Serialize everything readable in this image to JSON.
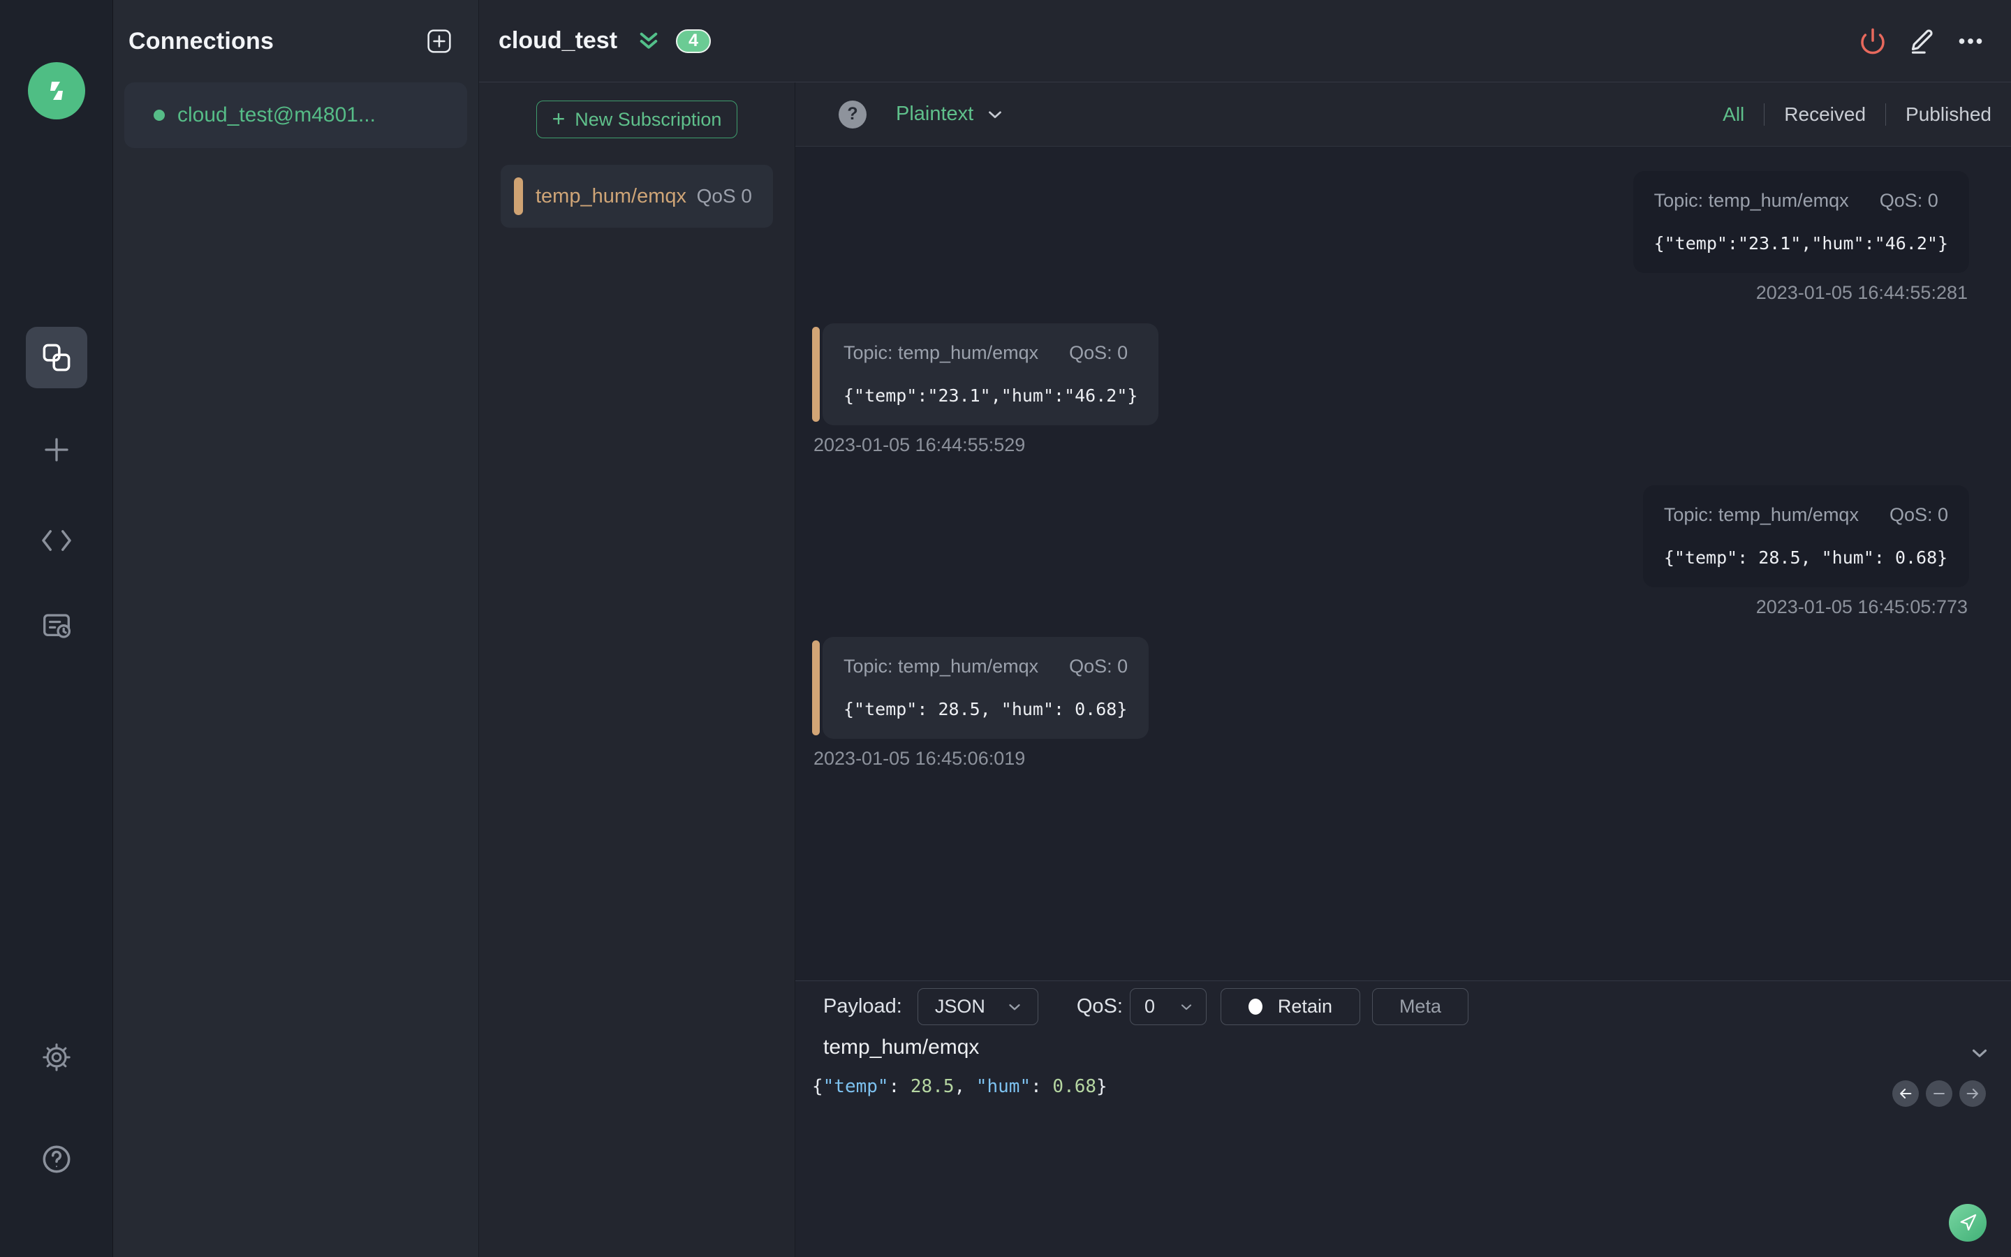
{
  "connections": {
    "title": "Connections",
    "items": [
      {
        "name": "cloud_test@m4801...",
        "status": "connected"
      }
    ]
  },
  "header": {
    "title": "cloud_test",
    "badge": "4"
  },
  "subscriptions": {
    "new_button": "New Subscription",
    "plus": "+",
    "items": [
      {
        "topic": "temp_hum/emqx",
        "qos": "QoS 0"
      }
    ]
  },
  "filter": {
    "format": "Plaintext",
    "help": "?",
    "tabs": [
      "All",
      "Received",
      "Published"
    ],
    "active_tab": "All"
  },
  "messages": [
    {
      "direction": "published",
      "topic": "Topic: temp_hum/emqx",
      "qos": "QoS: 0",
      "payload": "{\"temp\":\"23.1\",\"hum\":\"46.2\"}",
      "time": "2023-01-05 16:44:55:281"
    },
    {
      "direction": "received",
      "topic": "Topic: temp_hum/emqx",
      "qos": "QoS: 0",
      "payload": "{\"temp\":\"23.1\",\"hum\":\"46.2\"}",
      "time": "2023-01-05 16:44:55:529"
    },
    {
      "direction": "published",
      "topic": "Topic: temp_hum/emqx",
      "qos": "QoS: 0",
      "payload": "{\"temp\": 28.5, \"hum\": 0.68}",
      "time": "2023-01-05 16:45:05:773"
    },
    {
      "direction": "received",
      "topic": "Topic: temp_hum/emqx",
      "qos": "QoS: 0",
      "payload": "{\"temp\": 28.5, \"hum\": 0.68}",
      "time": "2023-01-05 16:45:06:019"
    }
  ],
  "publish": {
    "payload_label": "Payload:",
    "format_value": "JSON",
    "qos_label": "QoS:",
    "qos_value": "0",
    "retain_label": "Retain",
    "meta_label": "Meta",
    "topic_value": "temp_hum/emqx",
    "editor_tokens": [
      {
        "t": "{",
        "c": "p"
      },
      {
        "t": "\"temp\"",
        "c": "k"
      },
      {
        "t": ": ",
        "c": "p"
      },
      {
        "t": "28.5",
        "c": "n"
      },
      {
        "t": ", ",
        "c": "p"
      },
      {
        "t": "\"hum\"",
        "c": "k"
      },
      {
        "t": ": ",
        "c": "p"
      },
      {
        "t": "0.68",
        "c": "n"
      },
      {
        "t": "}",
        "c": "p"
      }
    ]
  },
  "colors": {
    "accent_green": "#5fc08b",
    "badge_green": "#6bcb94",
    "topic_tan": "#cfa577",
    "danger_red": "#e8695d",
    "json_key_blue": "#7dc1ef",
    "json_number_green": "#b6d7a2"
  },
  "icons": {
    "logo": "mqttx-bolt",
    "sidebar_connections": "overlapping-squares",
    "sidebar_new": "plus",
    "sidebar_script": "code-slash",
    "sidebar_log": "document-clock",
    "settings": "gear",
    "help": "question-circle",
    "add_connection": "plus-square",
    "disconnect": "power",
    "edit": "pencil-underline",
    "more": "ellipsis",
    "collapse_all": "double-chevron-down",
    "dropdown": "chevron-down",
    "format_help": "question-filled",
    "retain": "dot",
    "history_back": "arrow-left",
    "history_clear": "minus",
    "history_forward": "arrow-right",
    "send": "paper-plane"
  }
}
